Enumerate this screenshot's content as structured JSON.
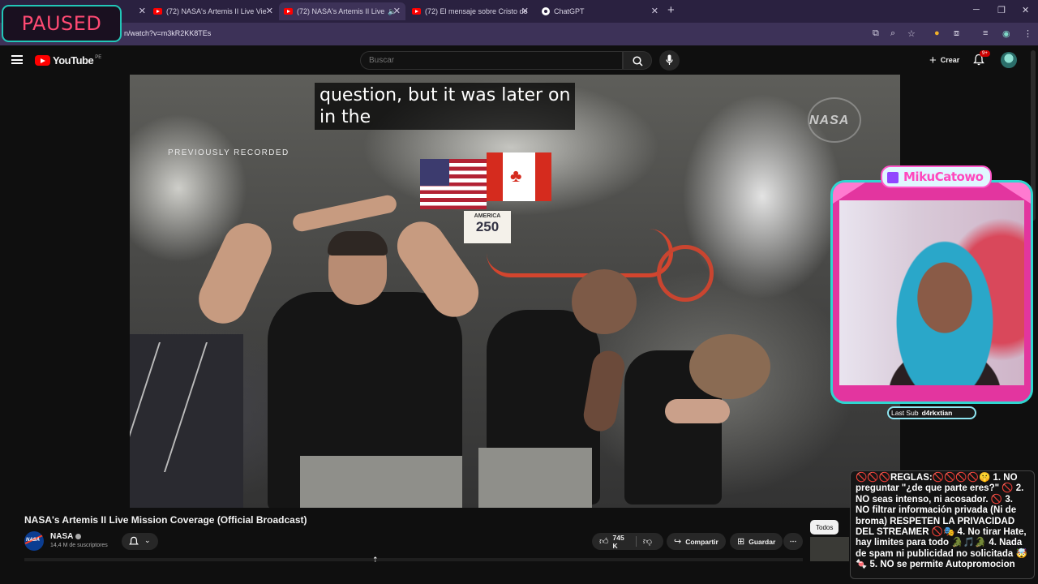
{
  "overlay": {
    "paused_label": "PAUSED"
  },
  "browser": {
    "tabs": [
      {
        "title": "(72) NASA's Artemis II Live Vie"
      },
      {
        "title": "(72) NASA's Artemis II Live"
      },
      {
        "title": "(72) El mensaje sobre Cristo de"
      },
      {
        "title": "ChatGPT"
      }
    ],
    "url": "n/watch?v=m3kR2KK8TEs"
  },
  "youtube": {
    "logo_text": "YouTube",
    "region": "PE",
    "search_placeholder": "Buscar",
    "create_label": "Crear",
    "notifications_badge": "9+"
  },
  "video": {
    "caption_line1": "question, but it was later on",
    "caption_line2": "in the",
    "previously_recorded": "PREVIOUSLY RECORDED",
    "watermark": "NASA",
    "sign_text": "AMERICA",
    "sign_number": "250",
    "title": "NASA's Artemis II Live Mission Coverage (Official Broadcast)"
  },
  "channel": {
    "name": "NASA",
    "avatar_text": "NASA",
    "subscribers": "14,4 M de suscriptores"
  },
  "actions": {
    "likes": "745 K",
    "share_label": "Compartir",
    "save_label": "Guardar"
  },
  "filters": {
    "all_label": "Todos"
  },
  "stream": {
    "streamer_logo": "MikuCatowo",
    "last_sub_label": "Last Sub",
    "last_sub_name": "d4rkxtian",
    "rules_text": "🚫🚫🚫REGLAS:🚫🚫🚫🚫🤫 1. NO preguntar \"¿de que parte eres?\" 🚫 2. NO seas intenso, ni acosador. 🚫 3. NO filtrar información privada (Ni de broma) RESPETEN LA PRIVACIDAD DEL STREAMER 🚫🎭 4. No tirar Hate, hay limites para todo 🐊🎵🐊 4. Nada de spam ni publicidad no solicitada 🤯🍬 5. NO se permite Autopromocion"
  },
  "colors": {
    "yt_red": "#ff0000",
    "paused_pink": "#ff4a73",
    "frame_cyan": "#2fd6d0",
    "frame_pink": "#e3359f"
  }
}
